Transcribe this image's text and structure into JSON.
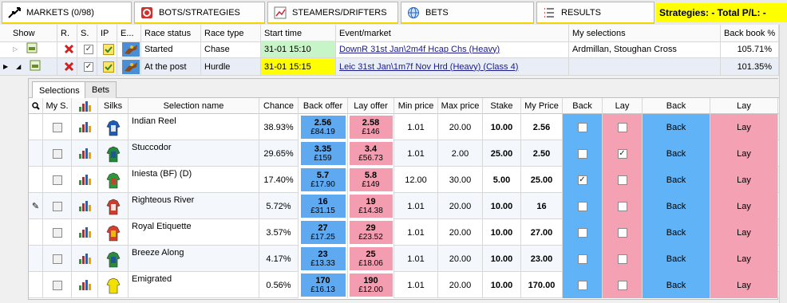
{
  "tabs": [
    {
      "label": "MARKETS (0/98)",
      "icon": "markets-arrows-icon"
    },
    {
      "label": "BOTS/STRATEGIES",
      "icon": "bots-icon"
    },
    {
      "label": "STEAMERS/DRIFTERS",
      "icon": "chart-icon"
    },
    {
      "label": "BETS",
      "icon": "globe-icon"
    },
    {
      "label": "RESULTS",
      "icon": "list-icon"
    }
  ],
  "strategies_label": "Strategies: -  Total P/L: -",
  "market_headers": {
    "show": "Show",
    "r": "R.",
    "s": "S.",
    "ip": "IP",
    "e": "E...",
    "race_status": "Race status",
    "race_type": "Race type",
    "start_time": "Start time",
    "event_market": "Event/market",
    "my_selections": "My selections",
    "back_book": "Back book %"
  },
  "markets": [
    {
      "status": "Started",
      "type": "Chase",
      "start": "31-01 15:10",
      "event": "DownR  31st Jan\\2m4f Hcap Chs (Heavy)",
      "selections": "Ardmillan, Stoughan Cross",
      "book": "105.71%"
    },
    {
      "status": "At the post",
      "type": "Hurdle",
      "start": "31-01 15:15",
      "event": "Leic  31st Jan\\1m7f Nov Hrd (Heavy) (Class 4)",
      "selections": "",
      "book": "101.35%"
    }
  ],
  "inner_tabs": [
    "Selections",
    "Bets"
  ],
  "sel_headers": {
    "my_s": "My S.",
    "silks": "Silks",
    "name": "Selection name",
    "chance": "Chance",
    "back_offer": "Back offer",
    "lay_offer": "Lay offer",
    "min_price": "Min price",
    "max_price": "Max price",
    "stake": "Stake",
    "my_price": "My Price",
    "back": "Back",
    "lay": "Lay",
    "back_btn": "Back",
    "lay_btn": "Lay"
  },
  "selections": [
    {
      "name": "Indian Reel",
      "chance": "38.93%",
      "back_price": "2.56",
      "back_amt": "£84.19",
      "lay_price": "2.58",
      "lay_amt": "£146",
      "min": "1.01",
      "max": "20.00",
      "stake": "10.00",
      "my_price": "2.56",
      "back_chk": "",
      "lay_chk": "",
      "back_btn": "Back",
      "lay_btn": "Lay",
      "colors": [
        "#1d5bb5",
        "#ffffff"
      ]
    },
    {
      "name": "Stuccodor",
      "chance": "29.65%",
      "back_price": "3.35",
      "back_amt": "£159",
      "lay_price": "3.4",
      "lay_amt": "£56.73",
      "min": "1.01",
      "max": "2.00",
      "stake": "25.00",
      "my_price": "2.50",
      "back_chk": "",
      "lay_chk": "✓",
      "back_btn": "Back",
      "lay_btn": "Lay",
      "colors": [
        "#1f8a3a",
        "#1d4fa0"
      ]
    },
    {
      "name": "Iniesta (BF) (D)",
      "chance": "17.40%",
      "back_price": "5.7",
      "back_amt": "£17.90",
      "lay_price": "5.8",
      "lay_amt": "£149",
      "min": "12.00",
      "max": "30.00",
      "stake": "5.00",
      "my_price": "25.00",
      "back_chk": "✓",
      "lay_chk": "",
      "back_btn": "Back",
      "lay_btn": "Lay",
      "colors": [
        "#2a9a3a",
        "#d43a2a"
      ]
    },
    {
      "name": "Righteous River",
      "chance": "5.72%",
      "back_price": "16",
      "back_amt": "£31.15",
      "lay_price": "19",
      "lay_amt": "£14.38",
      "min": "1.01",
      "max": "20.00",
      "stake": "10.00",
      "my_price": "16",
      "back_chk": "",
      "lay_chk": "",
      "back_btn": "Back",
      "lay_btn": "Lay",
      "colors": [
        "#d13b2a",
        "#ffffff"
      ]
    },
    {
      "name": "Royal Etiquette",
      "chance": "3.57%",
      "back_price": "27",
      "back_amt": "£17.25",
      "lay_price": "29",
      "lay_amt": "£23.52",
      "min": "1.01",
      "max": "20.00",
      "stake": "10.00",
      "my_price": "27.00",
      "back_chk": "",
      "lay_chk": "",
      "back_btn": "Back",
      "lay_btn": "Lay",
      "colors": [
        "#d6402a",
        "#f0d000"
      ]
    },
    {
      "name": "Breeze Along",
      "chance": "4.17%",
      "back_price": "23",
      "back_amt": "£13.33",
      "lay_price": "25",
      "lay_amt": "£18.06",
      "min": "1.01",
      "max": "20.00",
      "stake": "10.00",
      "my_price": "23.00",
      "back_chk": "",
      "lay_chk": "",
      "back_btn": "Back",
      "lay_btn": "Lay",
      "colors": [
        "#2a8c3c",
        "#1c4ea0"
      ]
    },
    {
      "name": "Emigrated",
      "chance": "0.56%",
      "back_price": "170",
      "back_amt": "£16.13",
      "lay_price": "190",
      "lay_amt": "£12.00",
      "min": "1.01",
      "max": "20.00",
      "stake": "10.00",
      "my_price": "170.00",
      "back_chk": "",
      "lay_chk": "",
      "back_btn": "Back",
      "lay_btn": "Lay",
      "colors": [
        "#f2e000",
        "#f2e000"
      ]
    }
  ],
  "colors": {
    "back_offer": "#5fa9f0",
    "lay_offer": "#f49db0",
    "accent_yellow": "#ffff00",
    "started_time_bg": "#c8f5c8",
    "post_time_bg": "#ffff00"
  }
}
